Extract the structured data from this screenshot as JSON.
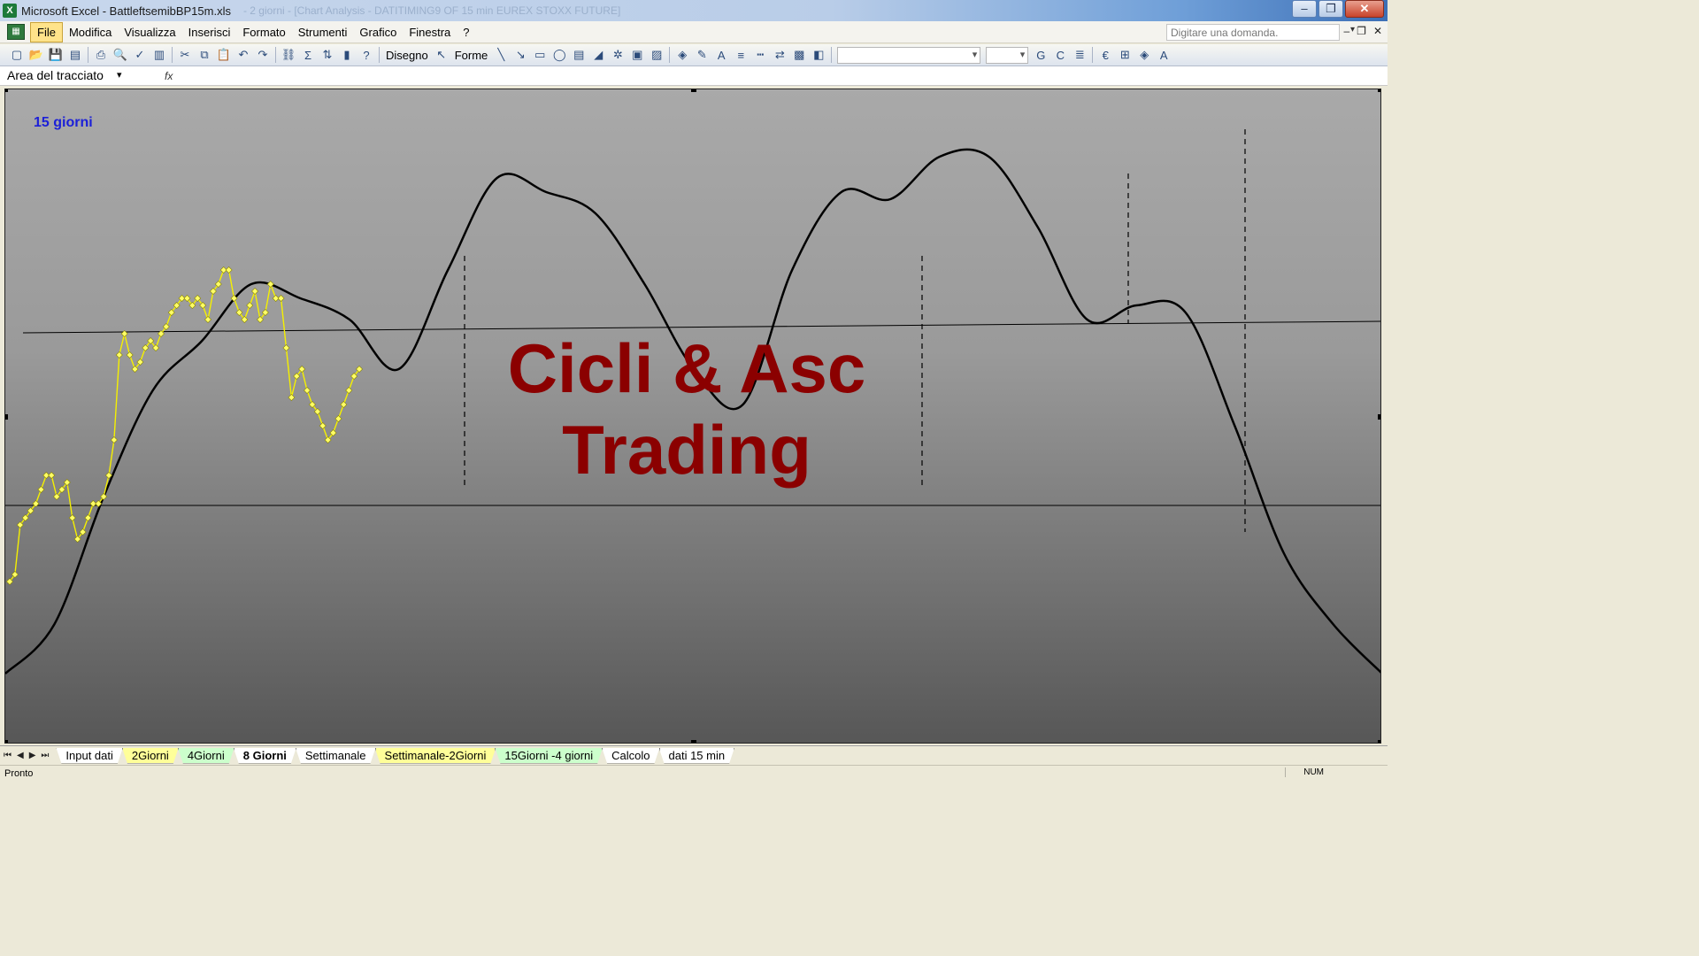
{
  "window": {
    "app_icon": "X",
    "title": "Microsoft Excel - BattleftsemibBP15m.xls",
    "title_extra": "- 2 giorni - [Chart Analysis - DATITIMING9 OF  15 min  EUREX STOXX FUTURE]",
    "minimize": "–",
    "restore": "❐",
    "close": "✕"
  },
  "menubar": {
    "items": [
      {
        "label": "File",
        "active": true
      },
      {
        "label": "Modifica"
      },
      {
        "label": "Visualizza"
      },
      {
        "label": "Inserisci"
      },
      {
        "label": "Formato"
      },
      {
        "label": "Strumenti"
      },
      {
        "label": "Grafico"
      },
      {
        "label": "Finestra"
      },
      {
        "label": "?"
      }
    ],
    "ask_placeholder": "Digitare una domanda.",
    "ask_arrow": "▾",
    "mdi": {
      "minimize": "–",
      "restore": "❐",
      "close": "✕"
    }
  },
  "toolbar": {
    "drawing_label": "Disegno",
    "shapes_label": "Forme",
    "bold": "G",
    "italic": "C",
    "euro": "€"
  },
  "formulabar": {
    "namebox_value": "Area del tracciato",
    "namebox_arrow": "▾",
    "fx": "fx"
  },
  "chart": {
    "label": "15 giorni",
    "watermark_line1": "Cicli & Asc",
    "watermark_line2": "Trading",
    "colors": {
      "label": "#1c20d8",
      "watermark": "#8b0000",
      "price": "#f5f000",
      "cycle": "#000000"
    }
  },
  "chart_data": {
    "type": "line",
    "series": [
      {
        "values": [
          18,
          19,
          26,
          27,
          28,
          29,
          31,
          33,
          33,
          30,
          31,
          32,
          27,
          24,
          25,
          27,
          29,
          29,
          30,
          33,
          38,
          50,
          53,
          50,
          48,
          49,
          51,
          52,
          51,
          53,
          54,
          56,
          57,
          58,
          58,
          57,
          58,
          57,
          55,
          59,
          60,
          62,
          62,
          58,
          56,
          55,
          57,
          59,
          55,
          56,
          60,
          58,
          58,
          51,
          44,
          47,
          48,
          45,
          43,
          42,
          40,
          38,
          39,
          41,
          43,
          45,
          47,
          48
        ]
      },
      {
        "values": [
          5,
          12,
          30,
          45,
          52,
          60,
          58,
          55,
          48,
          62,
          75,
          73,
          70,
          60,
          48,
          43,
          62,
          73,
          72,
          78,
          78,
          68,
          55,
          57,
          56,
          40,
          22,
          12,
          5
        ]
      }
    ]
  },
  "sheet_tabs": [
    {
      "label": "Input dati",
      "style": "white"
    },
    {
      "label": "2Giorni",
      "style": "yellow"
    },
    {
      "label": "4Giorni",
      "style": "green"
    },
    {
      "label": "8 Giorni",
      "style": "active"
    },
    {
      "label": "Settimanale",
      "style": "white"
    },
    {
      "label": "Settimanale-2Giorni",
      "style": "yellow"
    },
    {
      "label": "15Giorni -4 giorni",
      "style": "green"
    },
    {
      "label": "Calcolo",
      "style": "white"
    },
    {
      "label": "dati 15 min",
      "style": "white"
    }
  ],
  "sheet_nav": [
    "⏮",
    "◀",
    "▶",
    "⏭"
  ],
  "status": {
    "ready": "Pronto",
    "num": "NUM"
  }
}
